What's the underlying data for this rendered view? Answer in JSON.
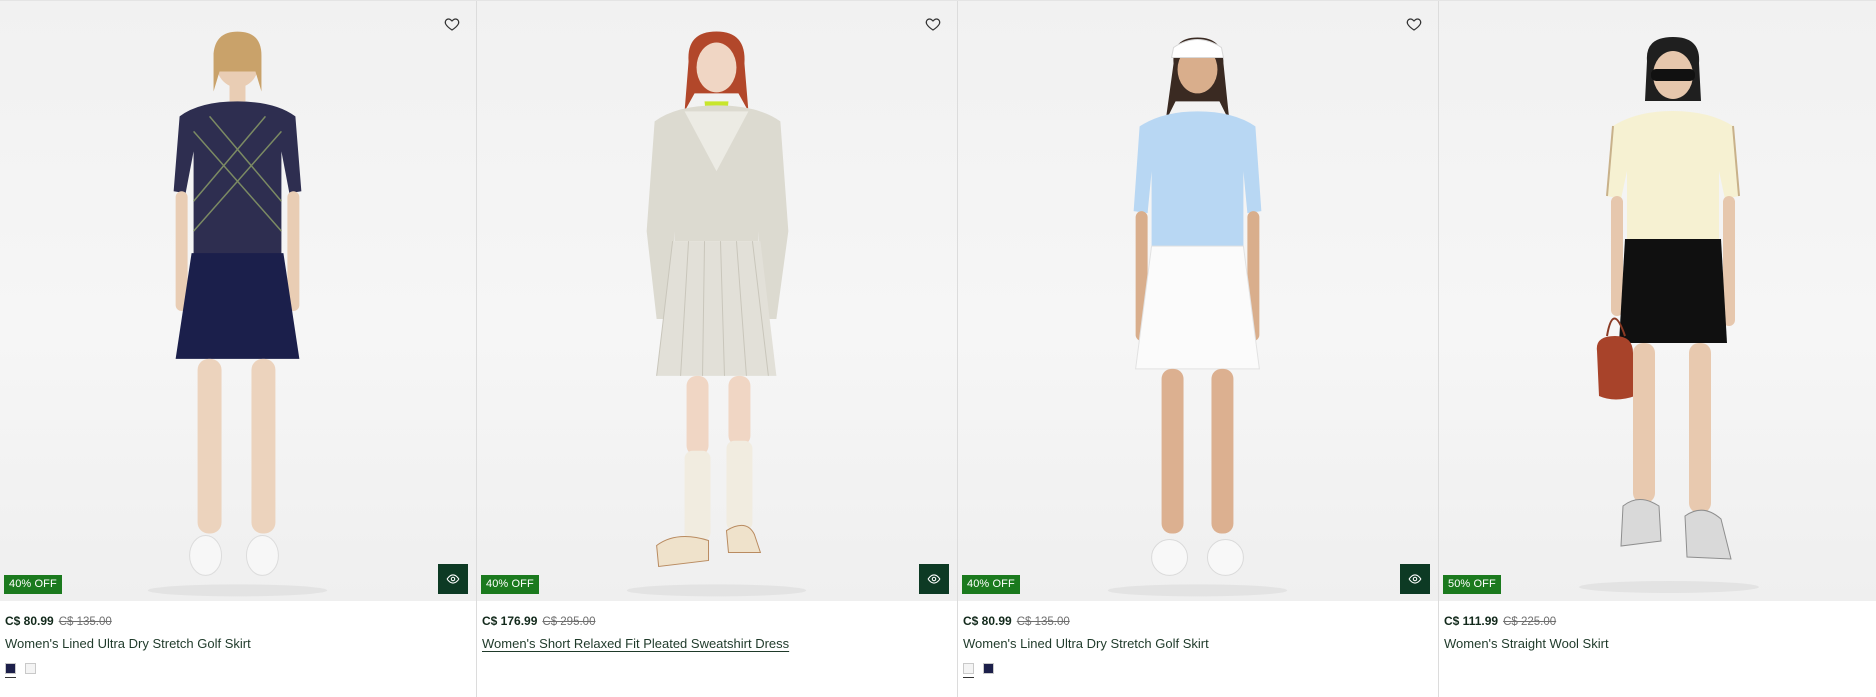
{
  "products": [
    {
      "badge": "40% OFF",
      "price": "C$ 80.99",
      "old_price": "C$ 135.00",
      "title": "Women's Lined Ultra Dry Stretch Golf Skirt",
      "swatches": [
        "#1c1f4a",
        "#f4f4f4"
      ],
      "selected_swatch": 0,
      "has_quick_view": true,
      "has_wishlist": true
    },
    {
      "badge": "40% OFF",
      "price": "C$ 176.99",
      "old_price": "C$ 295.00",
      "title": "Women's Short Relaxed Fit Pleated Sweatshirt Dress",
      "swatches": [],
      "has_quick_view": true,
      "has_wishlist": true
    },
    {
      "badge": "40% OFF",
      "price": "C$ 80.99",
      "old_price": "C$ 135.00",
      "title": "Women's Lined Ultra Dry Stretch Golf Skirt",
      "swatches": [
        "#f4f4f4",
        "#1c1f4a"
      ],
      "selected_swatch": 0,
      "has_quick_view": true,
      "has_wishlist": true
    },
    {
      "badge": "50% OFF",
      "price": "C$ 111.99",
      "old_price": "C$ 225.00",
      "title": "Women's Straight Wool Skirt",
      "swatches": [],
      "has_quick_view": false,
      "has_wishlist": false
    }
  ],
  "colors": {
    "badge_green": "#1b7a1e",
    "quick_view_bg": "#0d3a24"
  },
  "icons": {
    "wishlist": "heart-outline-icon",
    "quick_view": "eye-icon"
  }
}
